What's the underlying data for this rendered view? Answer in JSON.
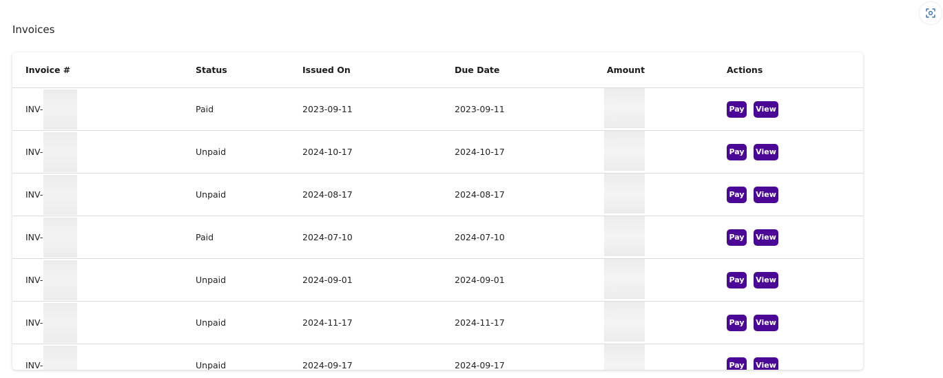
{
  "page": {
    "title": "Invoices"
  },
  "colors": {
    "button_bg": "#4b0896",
    "button_text": "#ffffff"
  },
  "table": {
    "columns": [
      "Invoice #",
      "Status",
      "Issued On",
      "Due Date",
      "Amount",
      "Actions"
    ],
    "rows": [
      {
        "invoice_prefix": "INV-",
        "status": "Paid",
        "issued_on": "2023-09-11",
        "due_date": "2023-09-11",
        "pay_label": "Pay",
        "view_label": "View"
      },
      {
        "invoice_prefix": "INV-",
        "status": "Unpaid",
        "issued_on": "2024-10-17",
        "due_date": "2024-10-17",
        "pay_label": "Pay",
        "view_label": "View"
      },
      {
        "invoice_prefix": "INV-",
        "status": "Unpaid",
        "issued_on": "2024-08-17",
        "due_date": "2024-08-17",
        "pay_label": "Pay",
        "view_label": "View"
      },
      {
        "invoice_prefix": "INV-",
        "status": "Paid",
        "issued_on": "2024-07-10",
        "due_date": "2024-07-10",
        "pay_label": "Pay",
        "view_label": "View"
      },
      {
        "invoice_prefix": "INV-",
        "status": "Unpaid",
        "issued_on": "2024-09-01",
        "due_date": "2024-09-01",
        "pay_label": "Pay",
        "view_label": "View"
      },
      {
        "invoice_prefix": "INV-",
        "status": "Unpaid",
        "issued_on": "2024-11-17",
        "due_date": "2024-11-17",
        "pay_label": "Pay",
        "view_label": "View"
      },
      {
        "invoice_prefix": "INV-",
        "status": "Unpaid",
        "issued_on": "2024-09-17",
        "due_date": "2024-09-17",
        "pay_label": "Pay",
        "view_label": "View"
      }
    ]
  },
  "icons": {
    "scan": "scan-icon"
  }
}
